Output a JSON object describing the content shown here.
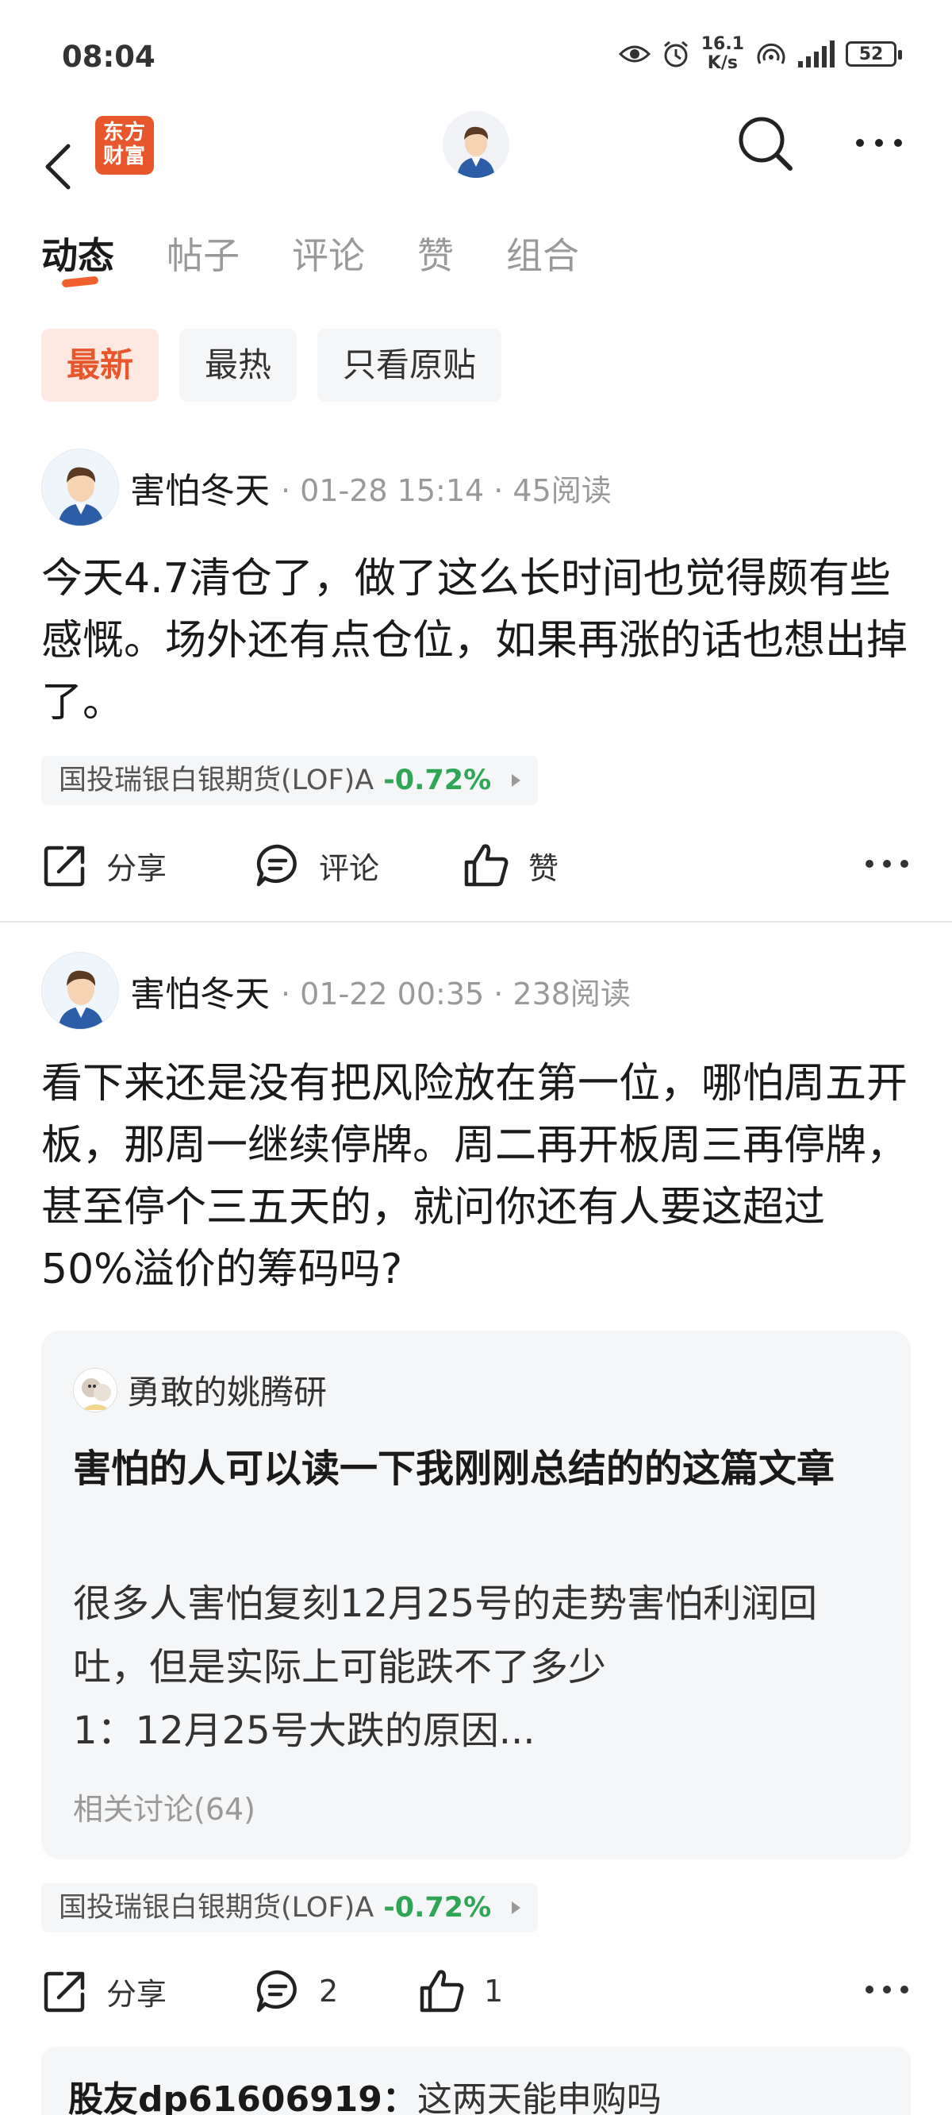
{
  "status_bar": {
    "time": "08:04",
    "net_speed_value": "16.1",
    "net_speed_unit": "K/s",
    "battery": "52"
  },
  "nav": {
    "logo_line1": "东方",
    "logo_line2": "财富"
  },
  "tabs": [
    {
      "label": "动态",
      "active": true
    },
    {
      "label": "帖子",
      "active": false
    },
    {
      "label": "评论",
      "active": false
    },
    {
      "label": "赞",
      "active": false
    },
    {
      "label": "组合",
      "active": false
    }
  ],
  "filters": [
    {
      "label": "最新",
      "active": true
    },
    {
      "label": "最热",
      "active": false
    },
    {
      "label": "只看原贴",
      "active": false
    }
  ],
  "posts": [
    {
      "author": "害怕冬天",
      "time": "· 01-28 15:14 · 45阅读",
      "body": "今天4.7清仓了，做了这么长时间也觉得颇有些感慨。场外还有点仓位，如果再涨的话也想出掉了。",
      "fund_name": "国投瑞银白银期货(LOF)A",
      "fund_change": "-0.72%",
      "share_label": "分享",
      "comment_label": "评论",
      "like_label": "赞"
    },
    {
      "author": "害怕冬天",
      "time": "· 01-22 00:35 · 238阅读",
      "body": "看下来还是没有把风险放在第一位，哪怕周五开板，那周一继续停牌。周二再开板周三再停牌，甚至停个三五天的，就问你还有人要这超过50%溢价的筹码吗?",
      "quote": {
        "user": "勇敢的姚腾研",
        "title": "害怕的人可以读一下我刚刚总结的的这篇文章",
        "summary_line1": "很多人害怕复刻12月25号的走势害怕利润回吐，但是实际上可能跌不了多少",
        "summary_line2": "1：12月25号大跌的原因...",
        "related": "相关讨论(64)"
      },
      "fund_name": "国投瑞银白银期货(LOF)A",
      "fund_change": "-0.72%",
      "share_label": "分享",
      "comment_count": "2",
      "like_count": "1",
      "reply": {
        "user": "股友dp61606919：",
        "text": "这两天能申购吗"
      }
    }
  ],
  "colors": {
    "accent": "#e8572b",
    "down_green": "#2fa655"
  }
}
